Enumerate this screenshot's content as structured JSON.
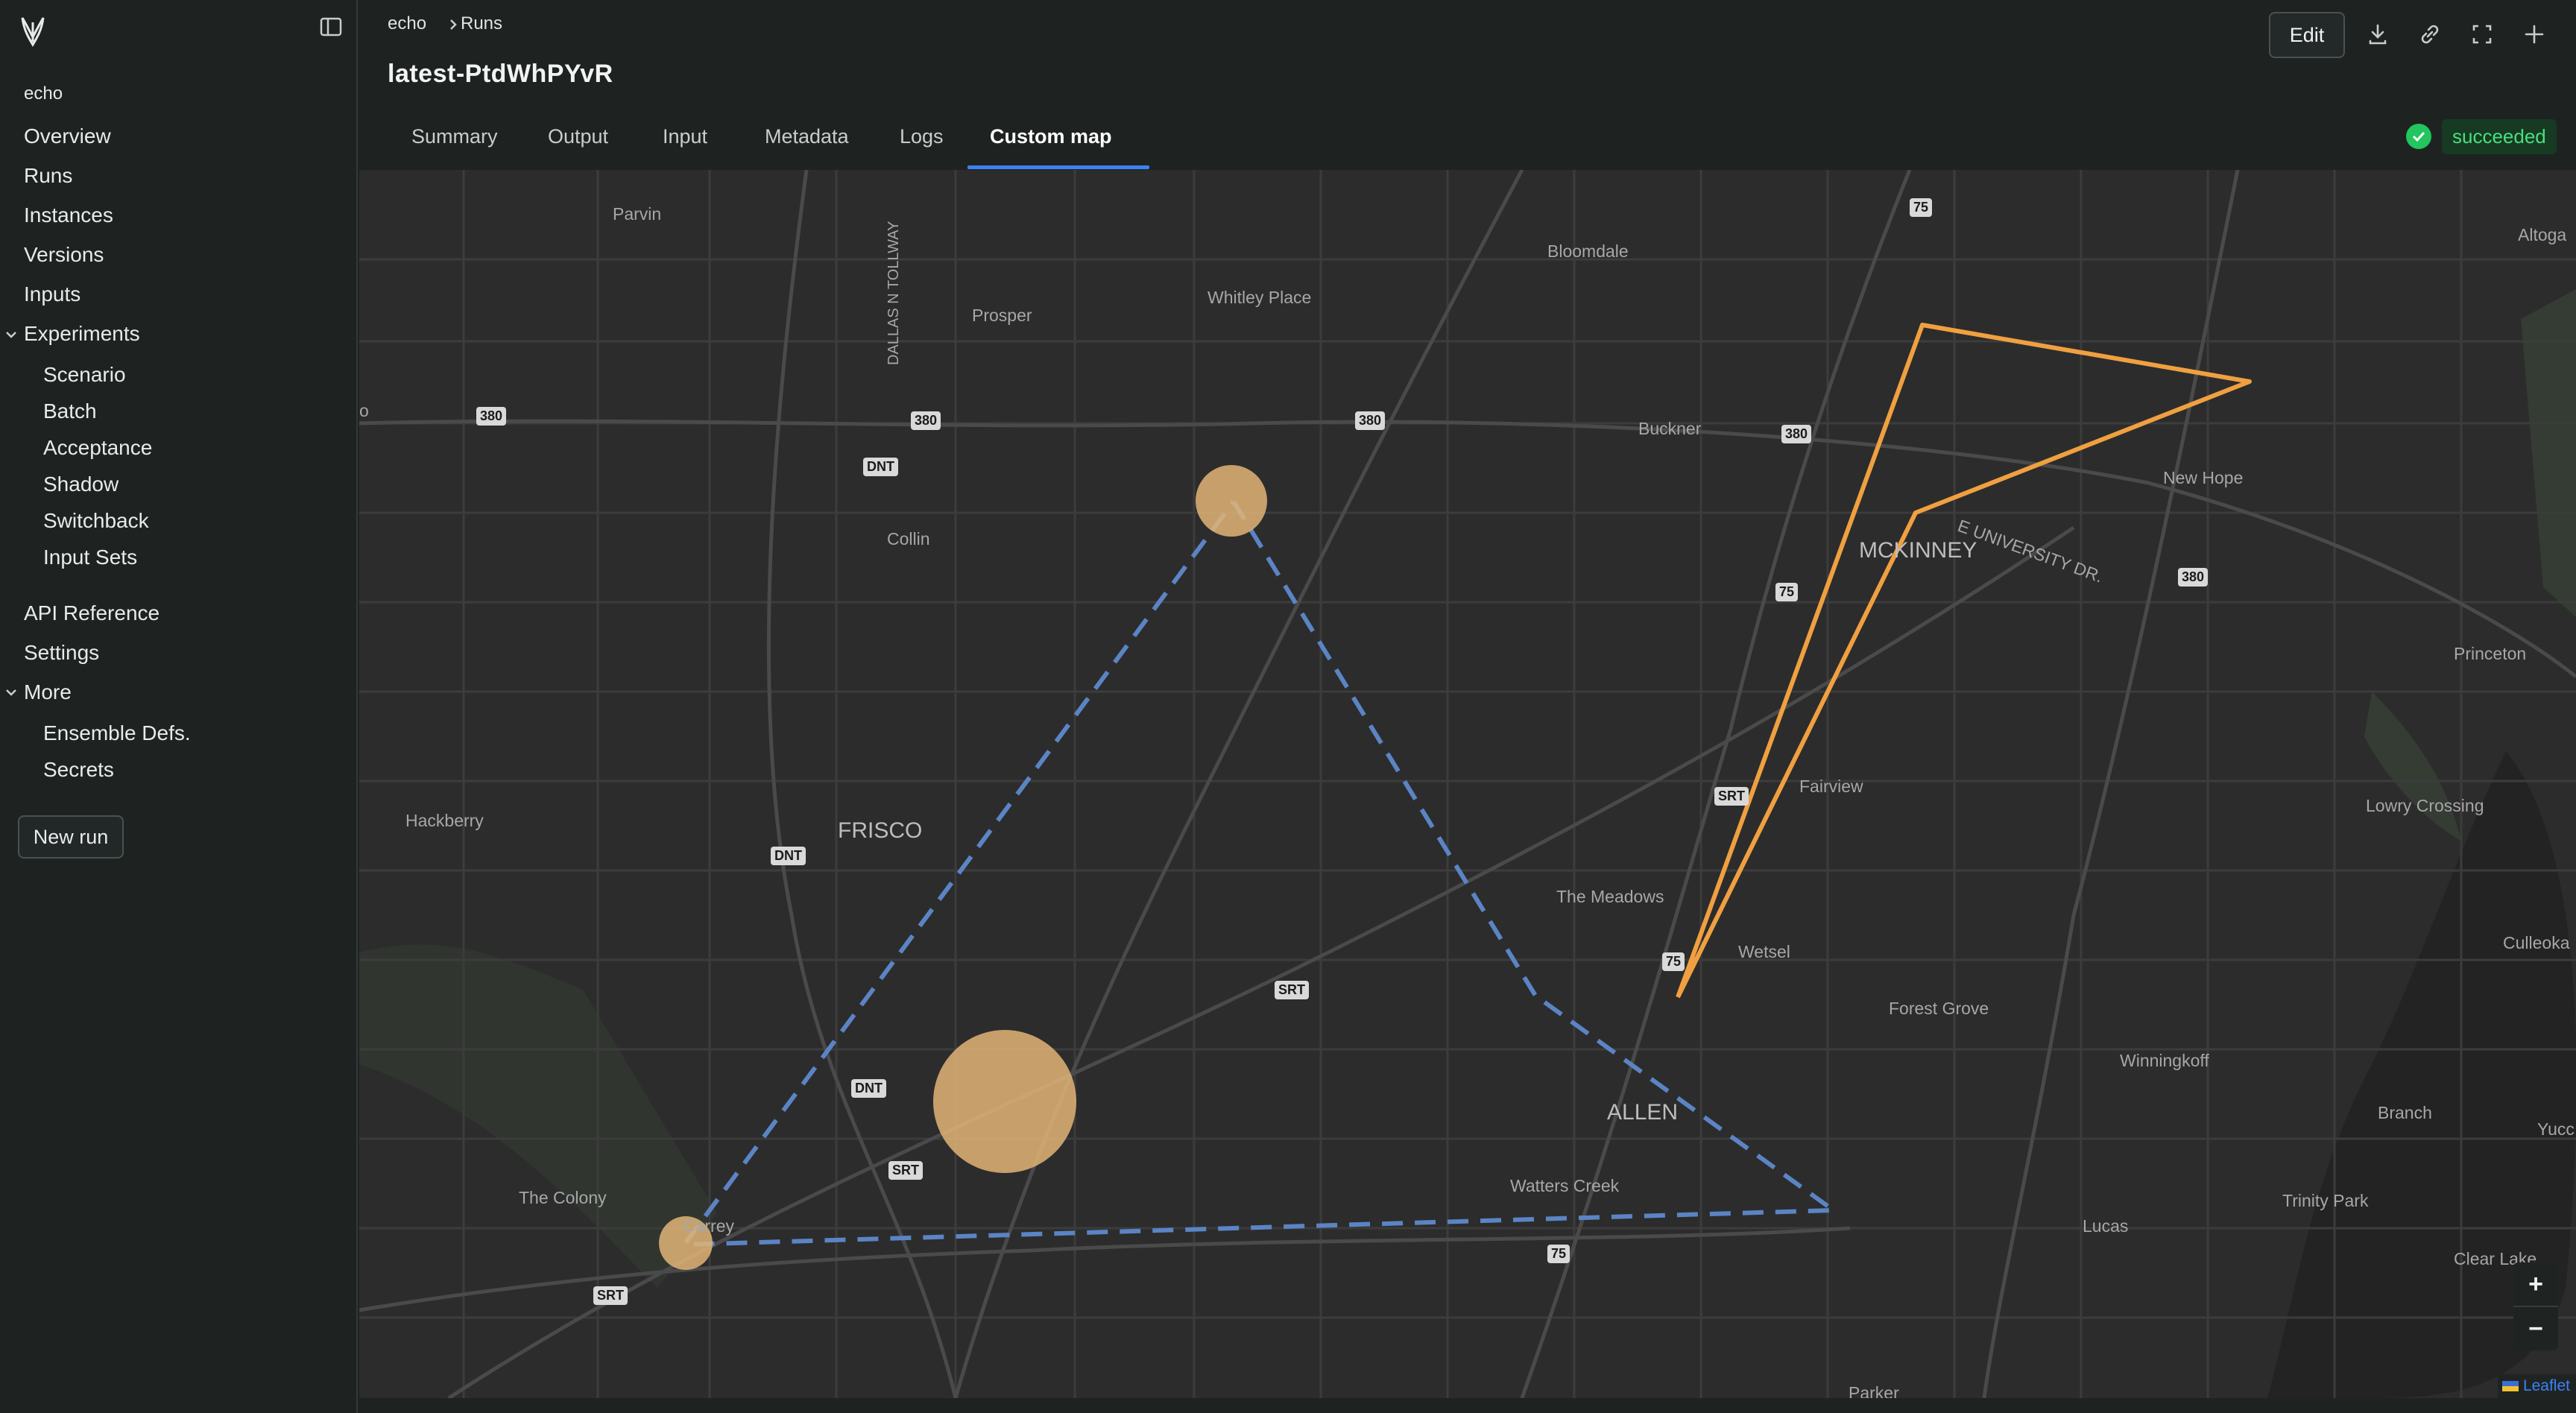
{
  "sidebar": {
    "project": "echo",
    "nav": [
      {
        "label": "Overview"
      },
      {
        "label": "Runs"
      },
      {
        "label": "Instances"
      },
      {
        "label": "Versions"
      },
      {
        "label": "Inputs"
      },
      {
        "label": "Experiments"
      }
    ],
    "experiments": [
      {
        "label": "Scenario"
      },
      {
        "label": "Batch"
      },
      {
        "label": "Acceptance"
      },
      {
        "label": "Shadow"
      },
      {
        "label": "Switchback"
      },
      {
        "label": "Input Sets"
      }
    ],
    "nav2": [
      {
        "label": "API Reference"
      },
      {
        "label": "Settings"
      },
      {
        "label": "More"
      }
    ],
    "more": [
      {
        "label": "Ensemble Defs."
      },
      {
        "label": "Secrets"
      }
    ],
    "new_run": "New run"
  },
  "header": {
    "breadcrumb": [
      "echo",
      "Runs"
    ],
    "title": "latest-PtdWhPYvR",
    "tabs": [
      "Summary",
      "Output",
      "Input",
      "Metadata",
      "Logs",
      "Custom map"
    ],
    "active_tab": "Custom map",
    "edit": "Edit",
    "status": "succeeded"
  },
  "map": {
    "places": [
      "Parvin",
      "Prosper",
      "Whitley Place",
      "Bloomdale",
      "Altoga",
      "Buckner",
      "New Hope",
      "MCKINNEY",
      "E UNIVERSITY DR.",
      "Collin",
      "Princeton",
      "Hackberry",
      "FRISCO",
      "Fairview",
      "Lowry Crossing",
      "The Meadows",
      "Wetsel",
      "Culleoka",
      "Forest Grove",
      "Winningkoff",
      "ALLEN",
      "Branch",
      "Yucc",
      "The Colony",
      "Carrey",
      "Watters Creek",
      "Lucas",
      "Trinity Park",
      "Clear Lake",
      "DALLAS N TOLLWAY",
      "Parker",
      "o"
    ],
    "shields": [
      "75",
      "380",
      "380",
      "380",
      "380",
      "DNT",
      "75",
      "380",
      "SRT",
      "DNT",
      "75",
      "SRT",
      "DNT",
      "SRT",
      "75",
      "SRT"
    ],
    "colors": {
      "route_orange": "#f0a040",
      "route_blue": "#5b84c4",
      "stop": "#e2b477"
    },
    "attribution": "Leaflet",
    "zoom_in": "+",
    "zoom_out": "−"
  }
}
